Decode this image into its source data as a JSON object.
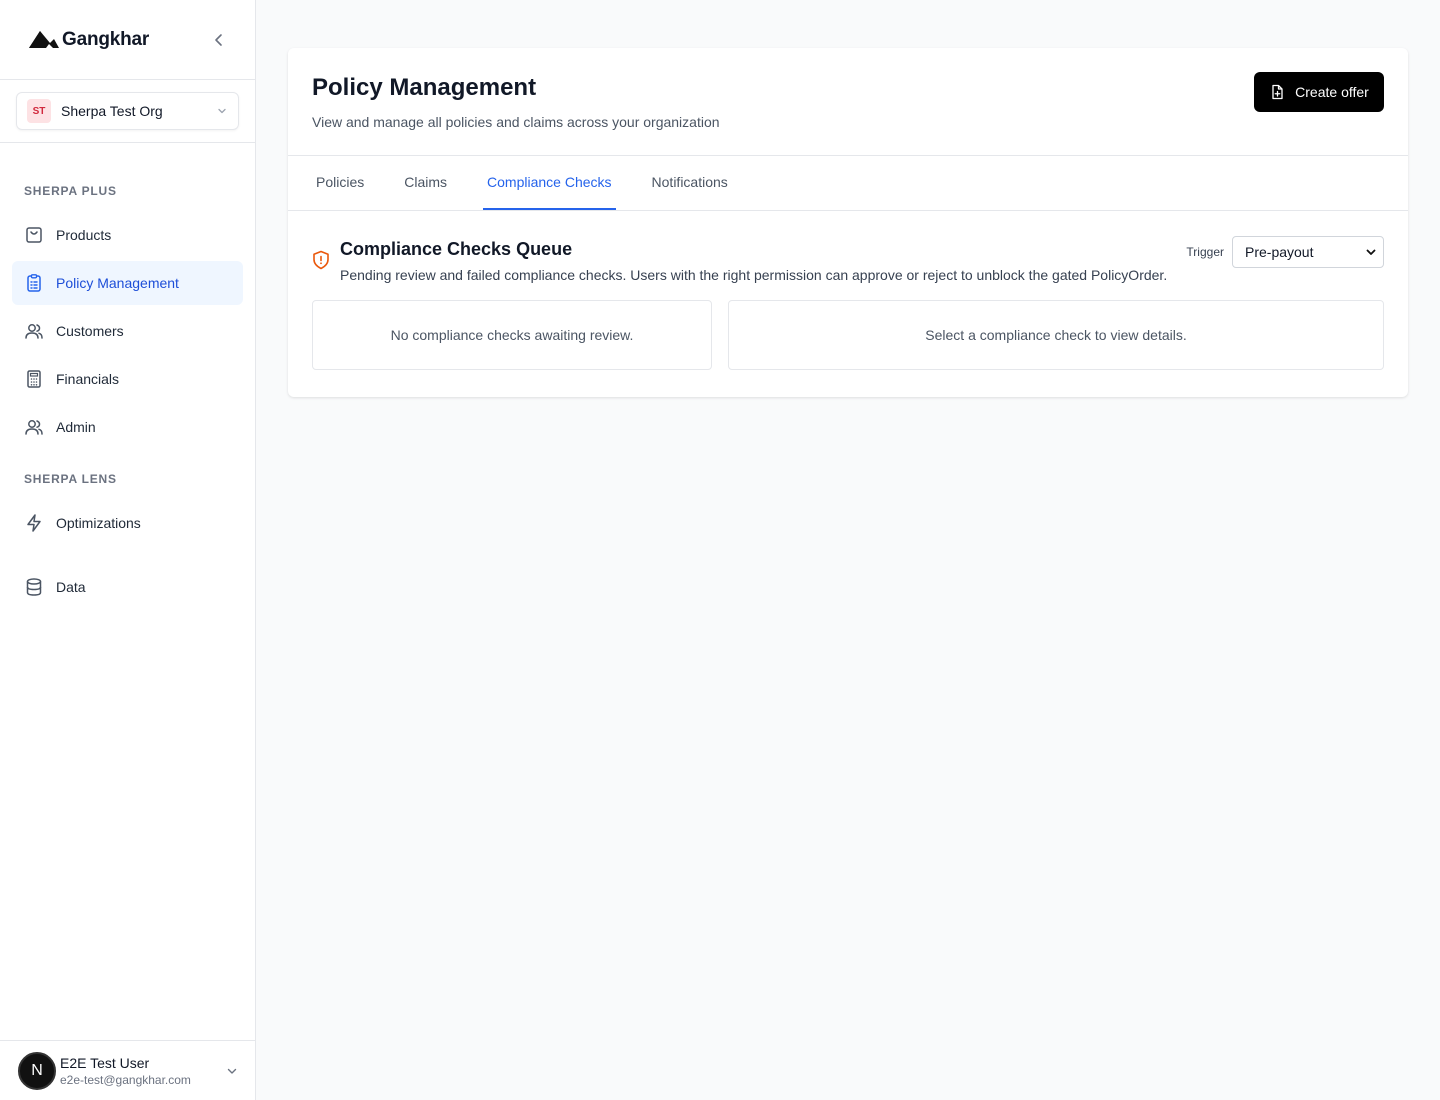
{
  "brand": {
    "name": "Gangkhar"
  },
  "org": {
    "initials": "ST",
    "name": "Sherpa Test Org"
  },
  "sidebar": {
    "sections": [
      {
        "heading": "SHERPA PLUS"
      },
      {
        "heading": "SHERPA LENS"
      }
    ],
    "items": {
      "products": "Products",
      "policy_management": "Policy Management",
      "customers": "Customers",
      "financials": "Financials",
      "admin": "Admin",
      "optimizations": "Optimizations",
      "data": "Data"
    },
    "active_item": "Policy Management"
  },
  "user": {
    "initial": "N",
    "name": "E2E Test User",
    "email": "e2e-test@gangkhar.com"
  },
  "header": {
    "title": "Policy Management",
    "subtitle": "View and manage all policies and claims across your organization",
    "create_label": "Create offer"
  },
  "tabs": [
    {
      "label": "Policies"
    },
    {
      "label": "Claims"
    },
    {
      "label": "Compliance Checks"
    },
    {
      "label": "Notifications"
    }
  ],
  "active_tab": "Compliance Checks",
  "queue": {
    "title": "Compliance Checks Queue",
    "description": "Pending review and failed compliance checks. Users with the right permission can approve or reject to unblock the gated PolicyOrder.",
    "trigger_label": "Trigger",
    "trigger_value": "Pre-payout",
    "empty_list": "No compliance checks awaiting review.",
    "empty_detail": "Select a compliance check to view details."
  },
  "colors": {
    "accent": "#2563eb",
    "active_bg": "#eff6ff",
    "warning": "#ea580c",
    "primary_button": "#000000"
  }
}
